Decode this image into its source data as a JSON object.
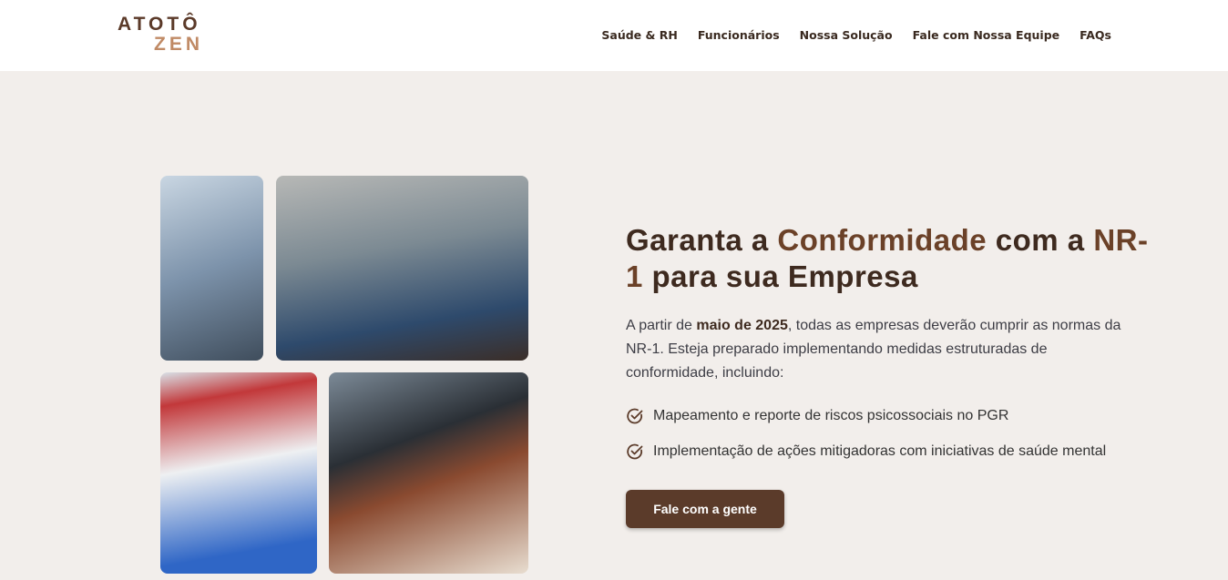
{
  "logo": {
    "line1": "ATOTÔ",
    "line2": "ZEN"
  },
  "nav": [
    "Saúde & RH",
    "Funcionários",
    "Nossa Solução",
    "Fale com Nossa Equipe",
    "FAQs"
  ],
  "hero": {
    "title_1": "Garanta a ",
    "title_hl1": "Conformidade",
    "title_2": " com a ",
    "title_hl2": "NR-1",
    "title_3": " para sua Empresa",
    "intro_1": "A partir de ",
    "intro_bold": "maio de 2025",
    "intro_2": ", todas as empresas deverão cumprir as normas da NR-1. Esteja preparado implementando medidas estruturadas de conformidade, incluindo:",
    "items": [
      "Mapeamento e reporte de riscos psicossociais no PGR",
      "Implementação de ações mitigadoras com iniciativas de saúde mental"
    ],
    "cta": "Fale com a gente"
  },
  "colors": {
    "brand": "#5b3b2a",
    "accent": "#c08a65"
  }
}
